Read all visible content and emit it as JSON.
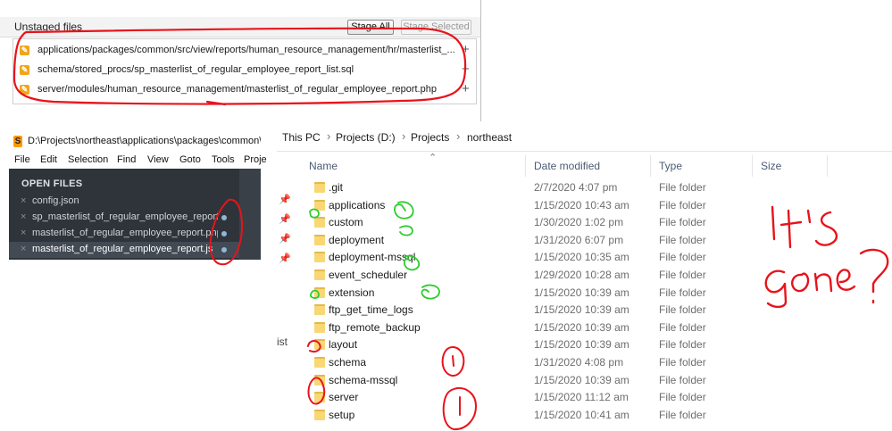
{
  "git": {
    "header": "Unstaged files",
    "stage_all": "Stage All",
    "stage_selected": "Stage Selected",
    "files": [
      {
        "path": "applications/packages/common/src/view/reports/human_resource_management/hr/masterlist_..."
      },
      {
        "path": "schema/stored_procs/sp_masterlist_of_regular_employee_report_list.sql"
      },
      {
        "path": "server/modules/human_resource_management/masterlist_of_regular_employee_report.php"
      }
    ],
    "add_glyph": "+",
    "modified_glyph": "✎"
  },
  "sublime": {
    "title": "D:\\Projects\\northeast\\applications\\packages\\common\\",
    "logo": "S",
    "menu": [
      "File",
      "Edit",
      "Selection",
      "Find",
      "View",
      "Goto",
      "Tools",
      "Proje"
    ],
    "open_files_label": "OPEN FILES",
    "close_glyph": "×",
    "files": [
      {
        "name": "config.json"
      },
      {
        "name": "sp_masterlist_of_regular_employee_report_l"
      },
      {
        "name": "masterlist_of_regular_employee_report.php"
      },
      {
        "name": "masterlist_of_regular_employee_report.js"
      }
    ]
  },
  "explorer": {
    "breadcrumb": [
      "This PC",
      "Projects (D:)",
      "Projects",
      "northeast"
    ],
    "breadcrumb_sep": "›",
    "columns": {
      "name": "Name",
      "date": "Date modified",
      "type": "Type",
      "size": "Size"
    },
    "nav_text": "ist",
    "rows": [
      {
        "name": ".git",
        "date": "2/7/2020 4:07 pm",
        "type": "File folder"
      },
      {
        "name": "applications",
        "date": "1/15/2020 10:43 am",
        "type": "File folder"
      },
      {
        "name": "custom",
        "date": "1/30/2020 1:02 pm",
        "type": "File folder"
      },
      {
        "name": "deployment",
        "date": "1/31/2020 6:07 pm",
        "type": "File folder"
      },
      {
        "name": "deployment-mssql",
        "date": "1/15/2020 10:35 am",
        "type": "File folder"
      },
      {
        "name": "event_scheduler",
        "date": "1/29/2020 10:28 am",
        "type": "File folder"
      },
      {
        "name": "extension",
        "date": "1/15/2020 10:39 am",
        "type": "File folder"
      },
      {
        "name": "ftp_get_time_logs",
        "date": "1/15/2020 10:39 am",
        "type": "File folder"
      },
      {
        "name": "ftp_remote_backup",
        "date": "1/15/2020 10:39 am",
        "type": "File folder"
      },
      {
        "name": "layout",
        "date": "1/15/2020 10:39 am",
        "type": "File folder"
      },
      {
        "name": "schema",
        "date": "1/31/2020 4:08 pm",
        "type": "File folder"
      },
      {
        "name": "schema-mssql",
        "date": "1/15/2020 10:39 am",
        "type": "File folder"
      },
      {
        "name": "server",
        "date": "1/15/2020 11:12 am",
        "type": "File folder"
      },
      {
        "name": "setup",
        "date": "1/15/2020 10:41 am",
        "type": "File folder"
      }
    ]
  },
  "annotations": {
    "exclaim": "!"
  },
  "colors": {
    "annotation_red": "#e8131b",
    "annotation_green": "#2ecc2e",
    "git_modified": "#f1a51b"
  }
}
